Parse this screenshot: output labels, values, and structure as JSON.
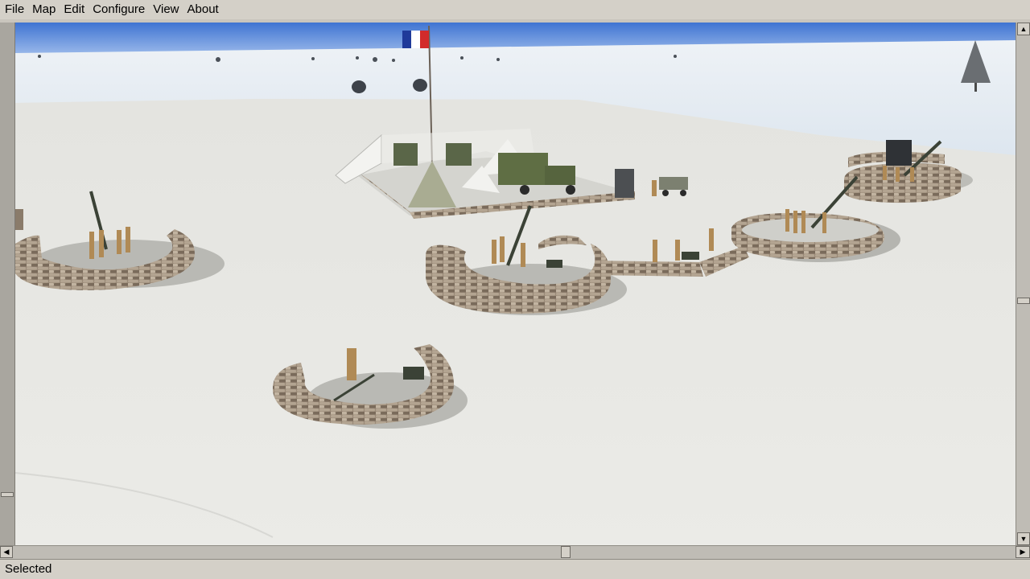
{
  "menubar": {
    "items": [
      {
        "label": "File"
      },
      {
        "label": "Map"
      },
      {
        "label": "Edit"
      },
      {
        "label": "Configure"
      },
      {
        "label": "View"
      },
      {
        "label": "About"
      }
    ]
  },
  "statusbar": {
    "text": "Selected"
  },
  "scroll": {
    "up_arrow": "▲",
    "down_arrow": "▼",
    "left_arrow": "◀",
    "right_arrow": "▶"
  },
  "colors": {
    "sky": "#4d7fd6",
    "snow": "#e9e9e6",
    "sandbag": "#8a7b6a",
    "soldier": "#b08a55",
    "vehicle": "#5b6b45",
    "flag_blue": "#1f3a9a",
    "flag_red": "#d22b2b"
  },
  "scene_objects": [
    {
      "name": "french-flag",
      "icon": "flag-icon"
    },
    {
      "name": "command-camp",
      "icon": "tent-icon"
    },
    {
      "name": "army-truck",
      "icon": "truck-icon"
    },
    {
      "name": "jeep",
      "icon": "jeep-icon"
    },
    {
      "name": "aa-gun-emplacement-left",
      "icon": "aa-gun-icon"
    },
    {
      "name": "aa-gun-emplacement-center",
      "icon": "aa-gun-icon"
    },
    {
      "name": "aa-gun-emplacement-right",
      "icon": "aa-gun-icon"
    },
    {
      "name": "aa-gun-emplacement-far-right",
      "icon": "aa-gun-icon"
    },
    {
      "name": "mortar-emplacement",
      "icon": "mortar-icon"
    },
    {
      "name": "snow-tree",
      "icon": "tree-icon"
    }
  ]
}
